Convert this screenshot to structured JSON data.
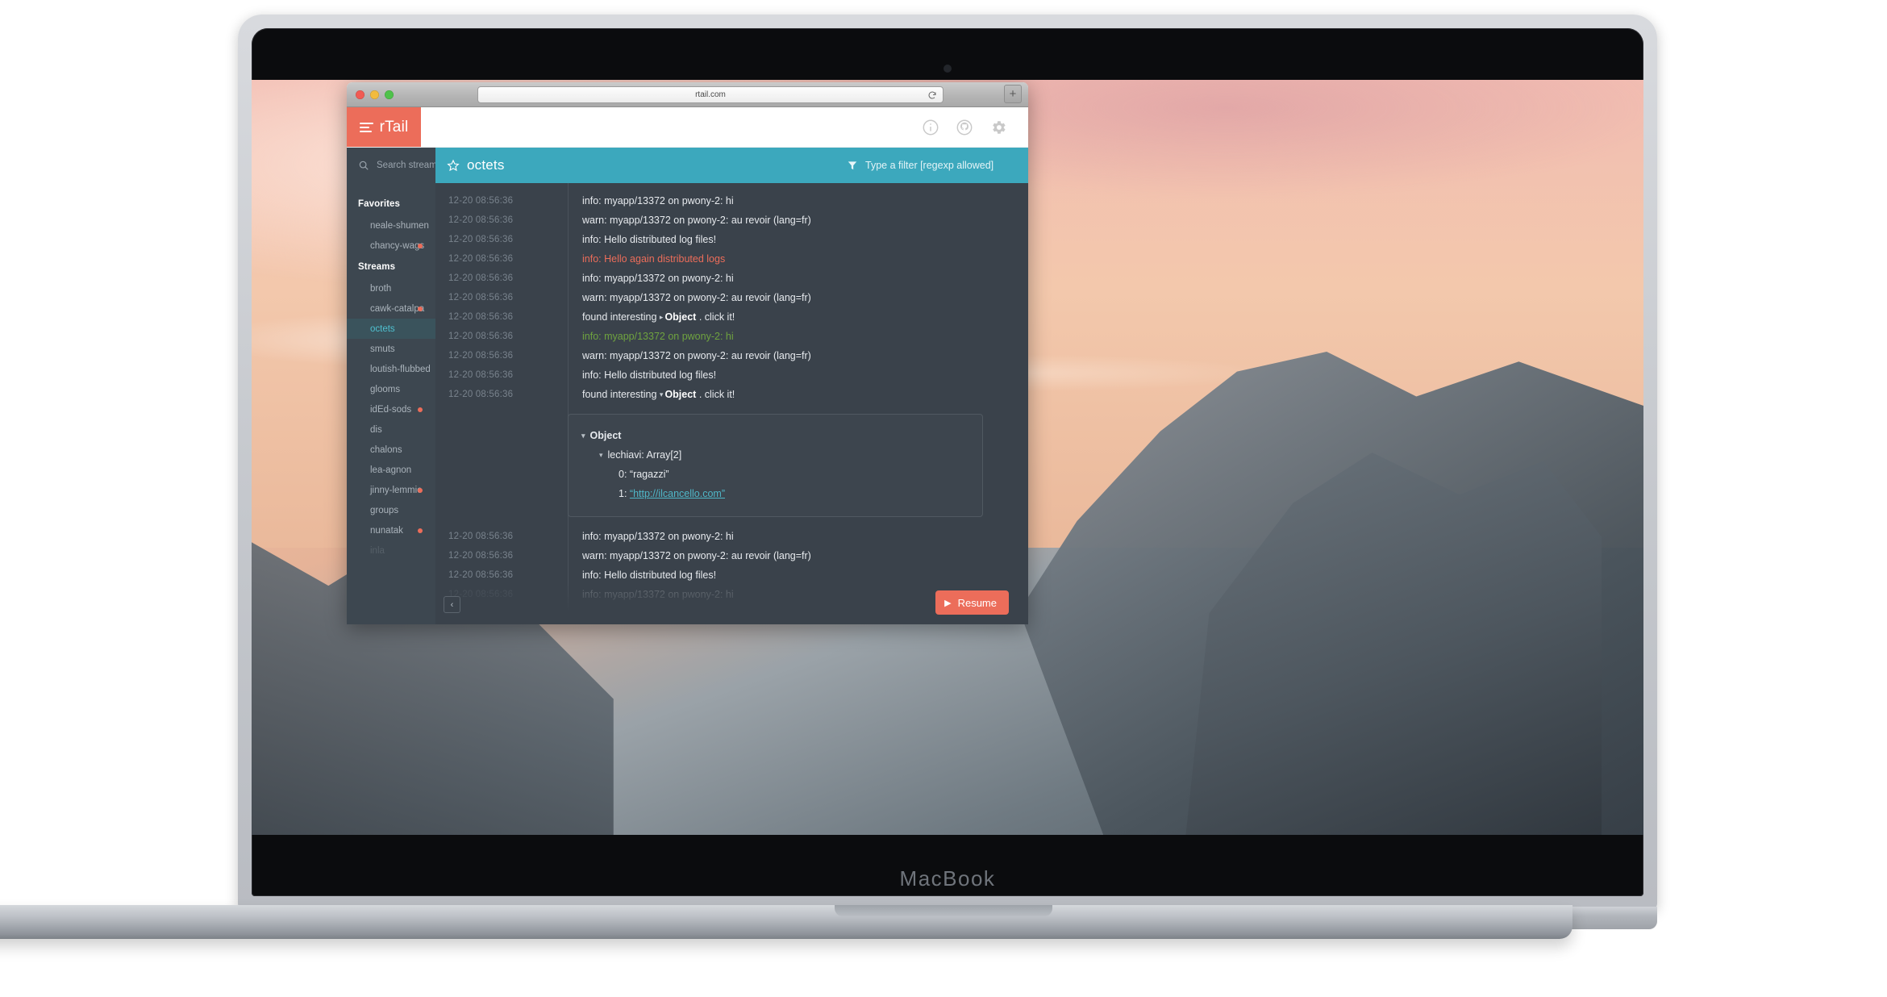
{
  "device": {
    "brand": "MacBook"
  },
  "browser": {
    "url": "rtail.com",
    "reload_icon": "reload-icon",
    "new_tab_label": "+",
    "traffic_lights": [
      "close",
      "minimize",
      "zoom"
    ]
  },
  "topbar": {
    "logo_text": "rTail",
    "logo_icon": "hamburger-lines-icon",
    "icons": [
      {
        "name": "info-icon",
        "label": "Info"
      },
      {
        "name": "github-icon",
        "label": "GitHub"
      },
      {
        "name": "gear-icon",
        "label": "Settings"
      }
    ]
  },
  "sidebar": {
    "search": {
      "placeholder": "Search streams",
      "value": "",
      "icon": "search-icon"
    },
    "groups": [
      {
        "title": "Favorites",
        "items": [
          {
            "label": "neale-shumen",
            "dot": false,
            "active": false
          },
          {
            "label": "chancy-wags",
            "dot": true,
            "active": false
          }
        ]
      },
      {
        "title": "Streams",
        "items": [
          {
            "label": "broth",
            "dot": false,
            "active": false
          },
          {
            "label": "cawk-catalpa",
            "dot": true,
            "active": false
          },
          {
            "label": "octets",
            "dot": false,
            "active": true
          },
          {
            "label": "smuts",
            "dot": false,
            "active": false
          },
          {
            "label": "loutish-flubbed",
            "dot": false,
            "active": false
          },
          {
            "label": "glooms",
            "dot": false,
            "active": false
          },
          {
            "label": "idEd-sods",
            "dot": true,
            "active": false
          },
          {
            "label": "dis",
            "dot": false,
            "active": false
          },
          {
            "label": "chalons",
            "dot": false,
            "active": false
          },
          {
            "label": "lea-agnon",
            "dot": false,
            "active": false
          },
          {
            "label": "jinny-lemmie",
            "dot": true,
            "active": false
          },
          {
            "label": "groups",
            "dot": false,
            "active": false
          },
          {
            "label": "nunatak",
            "dot": true,
            "active": false
          },
          {
            "label": "inla",
            "dot": false,
            "active": false,
            "faded": true
          }
        ]
      }
    ]
  },
  "stream_header": {
    "star_icon": "star-outline-icon",
    "title": "octets",
    "filter": {
      "icon": "funnel-icon",
      "placeholder": "Type a filter [regexp allowed]",
      "value": ""
    }
  },
  "log": {
    "rows": [
      {
        "ts": "12-20  08:56:36",
        "text": "info: myapp/13372 on pwony-2: hi",
        "style": "default"
      },
      {
        "ts": "12-20  08:56:36",
        "text": "warn: myapp/13372 on pwony-2: au revoir (lang=fr)",
        "style": "default"
      },
      {
        "ts": "12-20  08:56:36",
        "text": "info: Hello distributed log files!",
        "style": "default"
      },
      {
        "ts": "12-20  08:56:36",
        "text": "info: Hello again distributed logs",
        "style": "red"
      },
      {
        "ts": "12-20  08:56:36",
        "text": "info: myapp/13372 on pwony-2: hi",
        "style": "default"
      },
      {
        "ts": "12-20  08:56:36",
        "text": "warn: myapp/13372 on pwony-2: au revoir (lang=fr)",
        "style": "default"
      },
      {
        "ts": "12-20  08:56:36",
        "text": "found interesting ▸ Object . click it!",
        "style": "object-collapsed"
      },
      {
        "ts": "12-20  08:56:36",
        "text": "info: myapp/13372 on pwony-2: hi",
        "style": "green"
      },
      {
        "ts": "12-20  08:56:36",
        "text": "warn: myapp/13372 on pwony-2: au revoir (lang=fr)",
        "style": "default"
      },
      {
        "ts": "12-20  08:56:36",
        "text": "info: Hello distributed log files!",
        "style": "default"
      },
      {
        "ts": "12-20  08:56:36",
        "text": "found interesting ▾ Object . click it!",
        "style": "object-expanded"
      }
    ],
    "object_row_prefix": "found interesting",
    "object_row_label": "Object",
    "object_row_suffix": ". click it!",
    "inspector": {
      "root_label": "Object",
      "key_label": "lechiavi: Array[2]",
      "entries": [
        {
          "index": "0:",
          "value": "“ragazzi”",
          "is_link": false
        },
        {
          "index": "1:",
          "value": "“http://ilcancello.com”",
          "is_link": true
        }
      ]
    },
    "rows_after": [
      {
        "ts": "12-20  08:56:36",
        "text": "info: myapp/13372 on pwony-2: hi",
        "style": "default"
      },
      {
        "ts": "12-20  08:56:36",
        "text": "warn: myapp/13372 on pwony-2: au revoir (lang=fr)",
        "style": "default"
      },
      {
        "ts": "12-20  08:56:36",
        "text": "info: Hello distributed log files!",
        "style": "default"
      },
      {
        "ts": "12-20  08:56:36",
        "text": "info: myapp/13372 on pwony-2: hi",
        "style": "dim"
      }
    ]
  },
  "footer": {
    "collapse_label": "‹",
    "resume_label": "Resume",
    "resume_icon": "play-icon"
  },
  "colors": {
    "brand_orange": "#ec6d5a",
    "header_teal": "#3ca8bd",
    "sidebar_bg": "#3d4750",
    "log_bg": "#3a424b",
    "active_item_bg": "#3a535c",
    "active_item_text": "#4fc0cf",
    "link_teal": "#4fb7c8",
    "log_green": "#6fa33f"
  }
}
